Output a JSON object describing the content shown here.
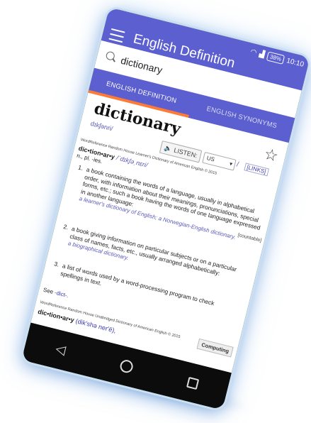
{
  "status": {
    "battery": "38%",
    "time": "10:10"
  },
  "appbar": {
    "title": "English Definition"
  },
  "search": {
    "value": "dictionary"
  },
  "tabs": [
    {
      "label": "ENGLISH DEFINITION"
    },
    {
      "label": "ENGLISH SYNONYMS"
    }
  ],
  "entry": {
    "headword": "dictionary",
    "pron": "dɪkʃənri/",
    "listen_label": "LISTEN:",
    "accent": "US",
    "slash": "/",
    "links": "[LINKS]",
    "source": "WordReference Random House Learner's Dictionary of American English © 2015",
    "syllables": "dic•tion•ar•y",
    "ipa": "/ˈdɪkʃəˌnɛri/",
    "pos": "n.,",
    "plural": "pl. -ies.",
    "countable": "[countable]",
    "senses": [
      {
        "num": "1.",
        "text": "a book containing the words of a language, usually in alphabetical order, with information about their meanings, pronunciations, special forms, etc.;",
        "text2": "such a book having the words of one language expressed in another language:",
        "example": "a learner's dictionary of English; a Norwegian-English dictionary."
      },
      {
        "num": "2.",
        "text": "a book giving information on particular subjects or on a particular class of names, facts, etc., usually arranged alphabetically:",
        "example": "a biographical dictionary."
      },
      {
        "num": "3.",
        "text": "a list of words used by a word-processing program to check spellings in text."
      }
    ],
    "see_label": "See",
    "see_link": "-dict-.",
    "computing": "Computing",
    "source2": "WordReference Random House Unabridged Dictionary of American English © 2015",
    "syllables2": "dic•tion•ar•y",
    "ipa2": "(dik′shə ner′ē),"
  }
}
